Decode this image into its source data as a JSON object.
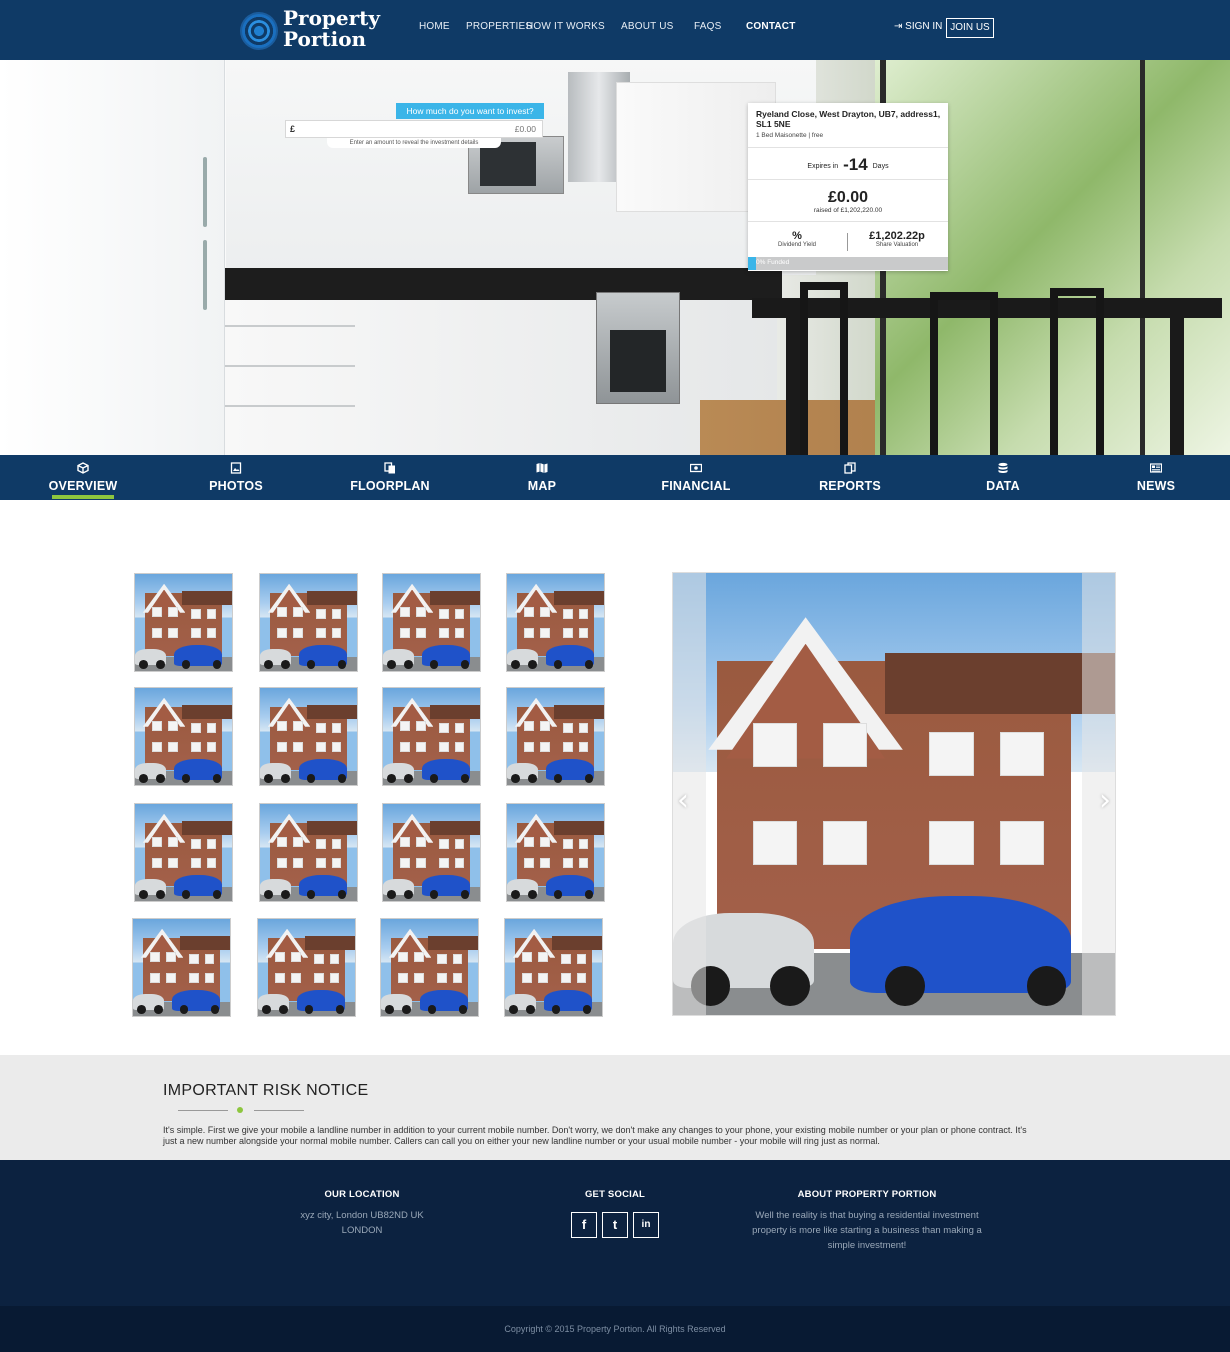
{
  "brand": {
    "name_line1": "Property",
    "name_line2": "Portion"
  },
  "nav": {
    "items": [
      {
        "label": "HOME",
        "active": false
      },
      {
        "label": "PROPERTIES",
        "active": false
      },
      {
        "label": "HOW IT WORKS",
        "active": false
      },
      {
        "label": "ABOUT US",
        "active": false
      },
      {
        "label": "FAQS",
        "active": false
      },
      {
        "label": "CONTACT",
        "active": true
      }
    ],
    "sign_in": "SIGN IN",
    "join_us": "JOIN US"
  },
  "invest": {
    "prompt": "How much do you want to invest?",
    "currency_symbol": "£",
    "placeholder": "£0.00",
    "hint": "Enter an amount to reveal the investment details"
  },
  "property": {
    "address": "Ryeland Close, West Drayton, UB7, address1, SL1 5NE",
    "subtitle": "1 Bed Maisonette | free",
    "expires_prefix": "Expires in",
    "expires_value": "-14",
    "expires_suffix": "Days",
    "amount": "£0.00",
    "raised": "raised of £1,202,220.00",
    "dividend_value": "%",
    "dividend_label": "Dividend Yield",
    "share_value": "£1,202.22p",
    "share_label": "Share Valuation",
    "funded_label": "0% Funded",
    "funded_fraction": 0.0
  },
  "tabs": [
    {
      "label": "OVERVIEW",
      "icon": "cube-icon",
      "active": true
    },
    {
      "label": "PHOTOS",
      "icon": "image-icon",
      "active": false
    },
    {
      "label": "FLOORPLAN",
      "icon": "copy-icon",
      "active": false
    },
    {
      "label": "MAP",
      "icon": "map-icon",
      "active": false
    },
    {
      "label": "FINANCIAL",
      "icon": "money-icon",
      "active": false
    },
    {
      "label": "REPORTS",
      "icon": "files-icon",
      "active": false
    },
    {
      "label": "DATA",
      "icon": "database-icon",
      "active": false
    },
    {
      "label": "NEWS",
      "icon": "newspaper-icon",
      "active": false
    }
  ],
  "gallery": {
    "thumbnail_count": 16
  },
  "slider": {
    "prev": "‹",
    "next": "›"
  },
  "risk": {
    "title": "IMPORTANT RISK NOTICE",
    "text": "It's simple. First we give your mobile a landline number in addition to your current mobile number. Don't worry, we don't make any changes to your phone, your existing mobile number or your plan or phone contract. It's just a new number alongside your normal mobile number. Callers can call you on either your new landline number or your usual mobile number - your mobile will ring just as normal."
  },
  "footer": {
    "location_title": "OUR LOCATION",
    "location_line1": "xyz city, London UB82ND UK",
    "location_line2": "LONDON",
    "social_title": "GET SOCIAL",
    "social": [
      {
        "glyph": "f",
        "icon": "facebook-icon"
      },
      {
        "glyph": "t",
        "icon": "twitter-icon"
      },
      {
        "glyph": "in",
        "icon": "linkedin-icon"
      }
    ],
    "about_title": "ABOUT PROPERTY PORTION",
    "about_text": "Well the reality is that buying a residential investment property is more like starting a business than making a simple investment!",
    "copyright": "Copyright © 2015 Property Portion. All Rights Reserved"
  },
  "colors": {
    "primary": "#0f3a66",
    "accent": "#3bb5e8",
    "active_underline": "#8dc63f",
    "footer": "#0c2240"
  }
}
